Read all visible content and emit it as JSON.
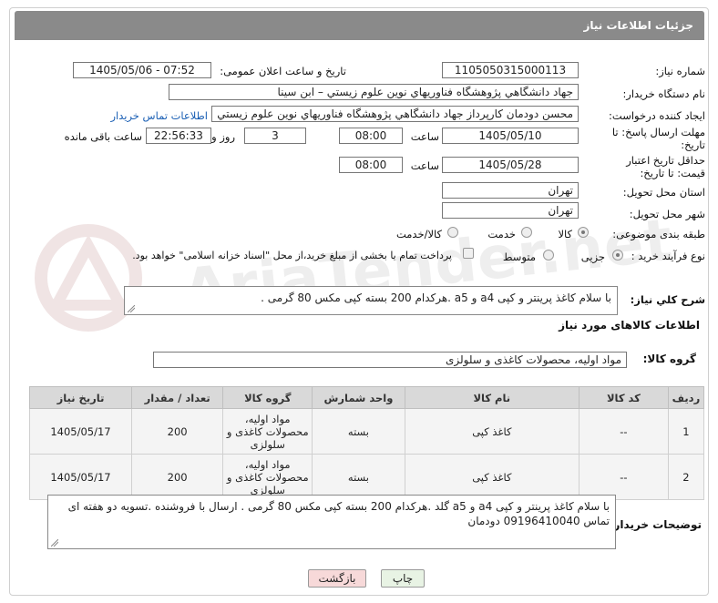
{
  "header": {
    "title": "جزئیات اطلاعات نیاز"
  },
  "watermark": {
    "text": "AriaTender.net"
  },
  "form": {
    "need_number": {
      "label": "شماره نیاز:",
      "value": "1105050315000113"
    },
    "announce_date": {
      "label": "تاریخ و ساعت اعلان عمومی:",
      "value": "1405/05/06 - 07:52"
    },
    "buyer_org": {
      "label": "نام دستگاه خریدار:",
      "value": "جهاد دانشگاهي پژوهشگاه فناوريهاي نوين علوم زيستي – ابن سينا"
    },
    "requester": {
      "label": "ایجاد کننده درخواست:",
      "value": "محسن دودمان كارپرداز جهاد دانشگاهي پژوهشگاه فناوريهاي نوين علوم زيستي",
      "contact_link": "اطلاعات تماس خریدار"
    },
    "deadline": {
      "label": "مهلت ارسال پاسخ: تا تاریخ:",
      "date": "1405/05/10",
      "time_label": "ساعت",
      "time": "08:00",
      "days": "3",
      "days_label": "روز و",
      "remaining": "22:56:33",
      "remaining_label": "ساعت باقی مانده"
    },
    "validity": {
      "label": "حداقل تاریخ اعتبار قیمت: تا تاریخ:",
      "date": "1405/05/28",
      "time_label": "ساعت",
      "time": "08:00"
    },
    "province": {
      "label": "استان محل تحویل:",
      "value": "تهران"
    },
    "city": {
      "label": "شهر محل تحویل:",
      "value": "تهران"
    },
    "category": {
      "label": "طبقه بندی موضوعی:",
      "options": [
        "کالا",
        "خدمت",
        "کالا/خدمت"
      ],
      "selected": "کالا"
    },
    "purchase_type": {
      "label": "نوع فرآیند خرید :",
      "options": [
        "جزیی",
        "متوسط"
      ],
      "selected": "جزیی",
      "note": "پرداخت تمام یا بخشی از مبلغ خرید،از محل \"اسناد خزانه اسلامی\" خواهد بود."
    }
  },
  "description": {
    "label": "شرح كلي نياز:",
    "value": "با سلام کاغذ پرینتر و کپی a4 و a5 .هرکدام 200 بسته کپی مکس 80 گرمی    ."
  },
  "goods": {
    "section_title": "اطلاعات کالاهای مورد نیاز",
    "group_label": "گروه کالا:",
    "group_value": "مواد اولیه، محصولات کاغذی و سلولزی",
    "columns": [
      "ردیف",
      "کد کالا",
      "نام کالا",
      "واحد شمارش",
      "گروه کالا",
      "تعداد / مقدار",
      "تاریخ نیاز"
    ],
    "rows": [
      {
        "row": "1",
        "code": "--",
        "name": "کاغذ کپی",
        "unit": "بسته",
        "group": "مواد اولیه، محصولات کاغذی و سلولزی",
        "qty": "200",
        "date": "1405/05/17"
      },
      {
        "row": "2",
        "code": "--",
        "name": "کاغذ کپی",
        "unit": "بسته",
        "group": "مواد اولیه، محصولات کاغذی و سلولزی",
        "qty": "200",
        "date": "1405/05/17"
      }
    ]
  },
  "buyer_notes": {
    "label": "توضیحات خریدار:",
    "value": "با سلام کاغذ پرینتر و کپی a4 و a5 گلد .هرکدام 200 بسته کپی مکس 80 گرمی    . ارسال با فروشنده .تسویه دو هفته ای تماس 09196410040 دودمان"
  },
  "actions": {
    "print": "چاپ",
    "back": "بازگشت"
  },
  "colors": {
    "header_bg": "#8a8a8a",
    "link": "#1a5fb4",
    "back_button_bg": "#f7d9d9",
    "print_button_bg": "#e8f3e4"
  }
}
